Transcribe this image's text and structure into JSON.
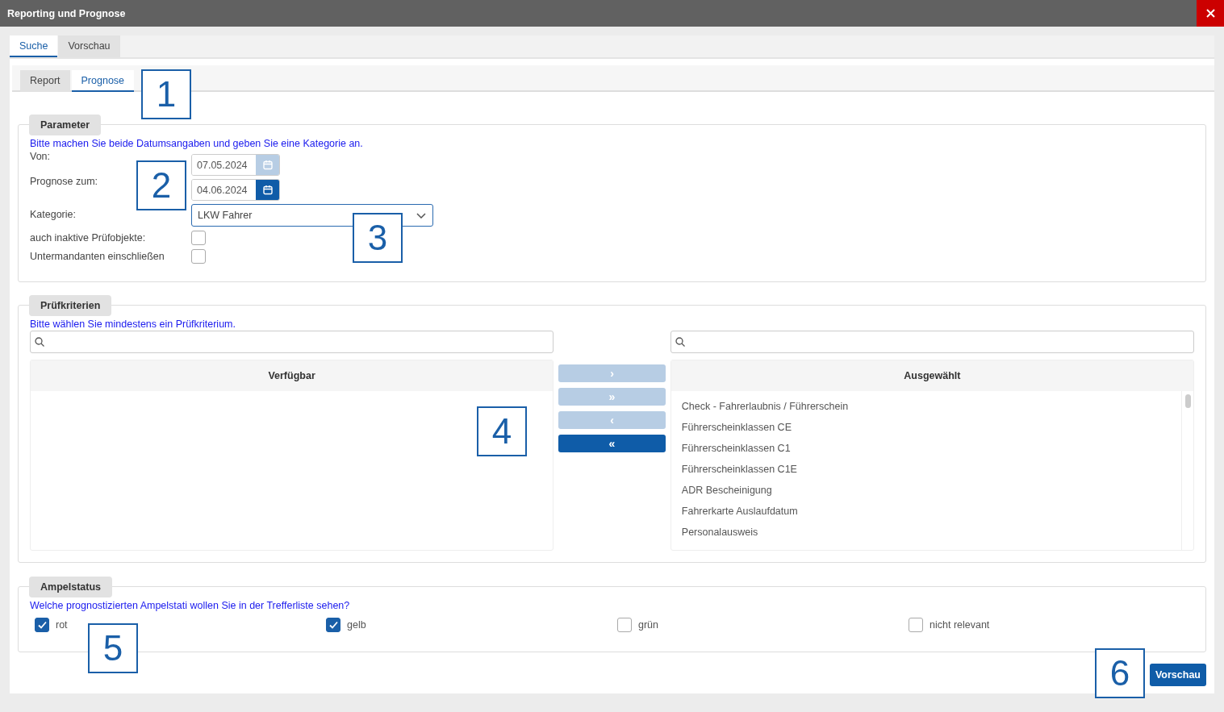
{
  "window": {
    "title": "Reporting und Prognose"
  },
  "tabs": [
    {
      "label": "Suche",
      "selected": true
    },
    {
      "label": "Vorschau",
      "selected": false
    }
  ],
  "subtabs": [
    {
      "label": "Report",
      "selected": false
    },
    {
      "label": "Prognose",
      "selected": true
    }
  ],
  "parameter": {
    "legend": "Parameter",
    "hint": "Bitte machen Sie beide Datumsangaben und geben Sie eine Kategorie an.",
    "fields": [
      {
        "kind": "date",
        "label": "Von:",
        "value": "07.05.2024",
        "disabled": true
      },
      {
        "kind": "date",
        "label": "Prognose zum:",
        "value": "04.06.2024",
        "disabled": false
      },
      {
        "kind": "select",
        "label": "Kategorie:",
        "value": "LKW Fahrer"
      },
      {
        "kind": "checkbox",
        "label": "auch inaktive Prüfobjekte:",
        "checked": false
      },
      {
        "kind": "checkbox",
        "label": "Untermandanten einschließen",
        "checked": false
      }
    ]
  },
  "criteria": {
    "legend": "Prüfkriterien",
    "hint": "Bitte wählen Sie mindestens ein Prüfkriterium.",
    "available": {
      "title": "Verfügbar"
    },
    "selected_list": {
      "title": "Ausgewählt",
      "items": [
        "Check - Fahrerlaubnis / Führerschein",
        "Führerscheinklassen CE",
        "Führerscheinklassen C1",
        "Führerscheinklassen C1E",
        "ADR Bescheinigung",
        "Fahrerkarte Auslaufdatum",
        "Personalausweis"
      ]
    },
    "move_buttons": [
      {
        "label": "›",
        "disabled": true
      },
      {
        "label": "»",
        "disabled": true
      },
      {
        "label": "‹",
        "disabled": true
      },
      {
        "label": "«",
        "disabled": false
      }
    ]
  },
  "status": {
    "legend": "Ampelstatus",
    "hint": "Welche prognostizierten Ampelstati wollen Sie in der Trefferliste sehen?",
    "options": [
      {
        "label": "rot",
        "checked": true
      },
      {
        "label": "gelb",
        "checked": true
      },
      {
        "label": "grün",
        "checked": false
      },
      {
        "label": "nicht relevant",
        "checked": false
      }
    ]
  },
  "preview_button": "Vorschau",
  "callouts": [
    "1",
    "2",
    "3",
    "4",
    "5",
    "6"
  ]
}
